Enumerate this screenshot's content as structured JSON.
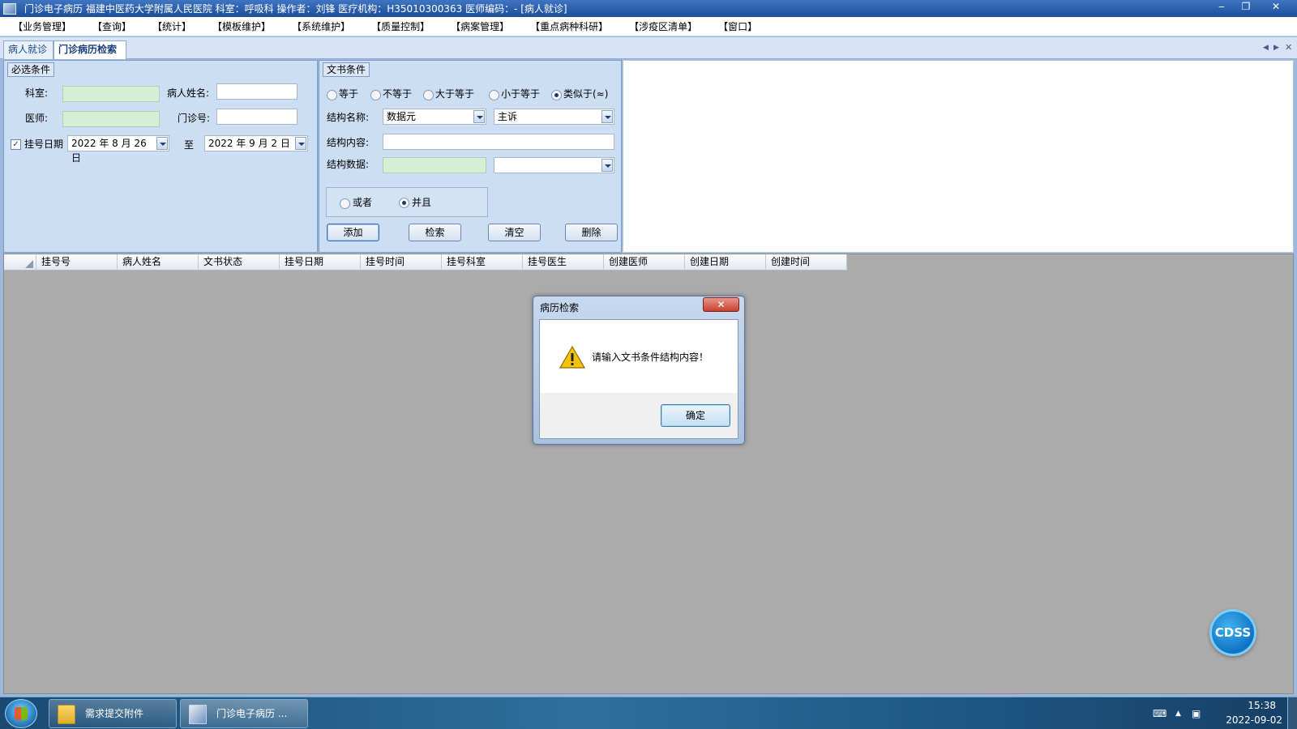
{
  "window": {
    "title": "门诊电子病历  福建中医药大学附属人民医院  科室：呼吸科  操作者：刘锋  医疗机构：H35010300363  医师编码：- [病人就诊]",
    "minimize": "‒",
    "restore": "❐",
    "close": "✕"
  },
  "menu": [
    "【业务管理】",
    "【查询】",
    "【统计】",
    "【模板维护】",
    "【系统维护】",
    "【质量控制】",
    "【病案管理】",
    "【重点病种科研】",
    "【涉疫区清单】",
    "【窗口】"
  ],
  "tabs": {
    "t1": "病人就诊",
    "t2": "门诊病历检索",
    "nav_prev": "◀",
    "nav_next": "▶",
    "close": "✕"
  },
  "required": {
    "title": "必选条件",
    "dept_label": "科室:",
    "dept_value": "",
    "patient_name_label": "病人姓名:",
    "patient_name_value": "",
    "doctor_label": "医师:",
    "doctor_value": "",
    "clinic_no_label": "门诊号:",
    "clinic_no_value": "",
    "reg_date_label": "挂号日期",
    "reg_date_checked": true,
    "date_from": "2022 年 8 月 26 日",
    "to_label": "至",
    "date_to": "2022 年 9 月 2 日"
  },
  "doc": {
    "title": "文书条件",
    "ops": [
      {
        "label": "等于",
        "selected": false
      },
      {
        "label": "不等于",
        "selected": false
      },
      {
        "label": "大于等于",
        "selected": false
      },
      {
        "label": "小于等于",
        "selected": false
      },
      {
        "label": "类似于(≈)",
        "selected": true
      }
    ],
    "struct_name_label": "结构名称:",
    "struct_name_value": "数据元",
    "struct_name_value2": "主诉",
    "struct_content_label": "结构内容:",
    "struct_content_value": "",
    "struct_data_label": "结构数据:",
    "struct_data_value": "",
    "struct_data_value2": "",
    "logic": [
      {
        "label": "或者",
        "selected": false
      },
      {
        "label": "并且",
        "selected": true
      }
    ],
    "buttons": {
      "add": "添加",
      "search": "检索",
      "clear": "清空",
      "delete": "删除"
    }
  },
  "grid": {
    "columns": [
      "挂号号",
      "病人姓名",
      "文书状态",
      "挂号日期",
      "挂号时间",
      "挂号科室",
      "挂号医生",
      "创建医师",
      "创建日期",
      "创建时间"
    ]
  },
  "dialog": {
    "title": "病历检索",
    "close": "✕",
    "message": "请输入文书条件结构内容！",
    "ok": "确定"
  },
  "cdss": "CDSS",
  "taskbar": {
    "items": [
      "需求提交附件",
      "门诊电子病历  ..."
    ],
    "time": "15:38",
    "date": "2022-09-02"
  },
  "colors": {
    "titlebar": "#1b4f9a",
    "panel": "#ccdef3",
    "grid_bg": "#ababab",
    "input_green": "#d4f0d3",
    "cdss": "#0f73c6"
  }
}
